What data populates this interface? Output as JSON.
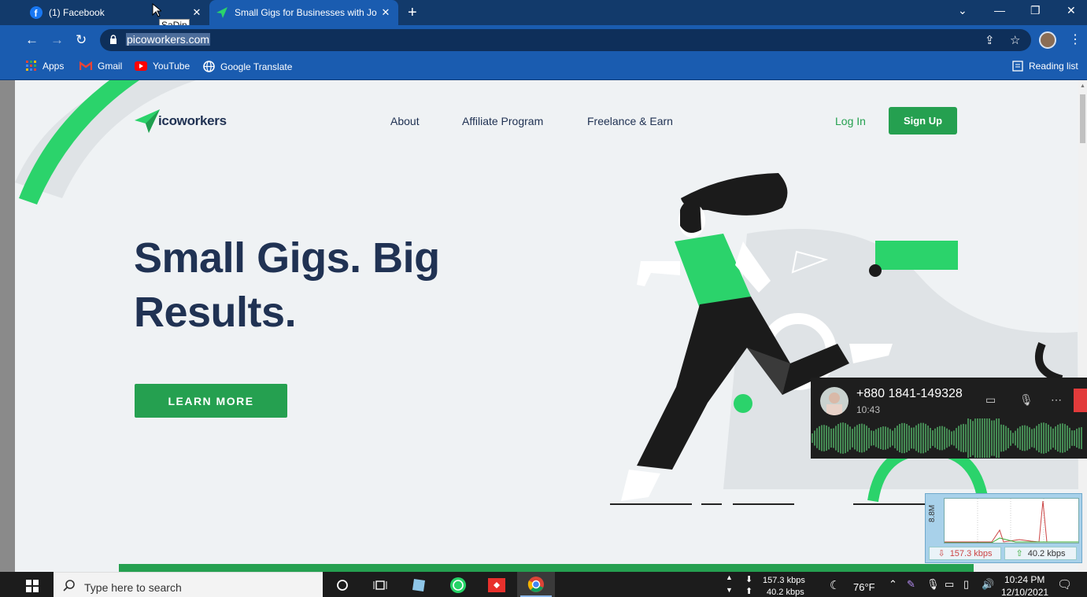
{
  "browser": {
    "tabs": [
      {
        "title": "(1) Facebook",
        "active": false
      },
      {
        "title": "Small Gigs for Businesses with Jo",
        "active": true
      }
    ],
    "tooltip": "SaDin",
    "url": "picoworkers.com",
    "bookmarks": [
      "Apps",
      "Gmail",
      "YouTube",
      "Google Translate"
    ],
    "reading_list": "Reading list"
  },
  "site": {
    "logo_text": "icoworkers",
    "nav": [
      "About",
      "Affiliate Program",
      "Freelance & Earn"
    ],
    "login": "Log In",
    "signup": "Sign Up",
    "hero_line1": "Small Gigs. Big",
    "hero_line2": "Results.",
    "cta": "LEARN MORE",
    "brand_color": "#25a050",
    "text_color": "#203253"
  },
  "call_overlay": {
    "number": "+880 1841-149328",
    "duration": "10:43"
  },
  "net_widget": {
    "scale": "8.8M",
    "download": "157.3 kbps",
    "upload": "40.2 kbps"
  },
  "taskbar": {
    "search_placeholder": "Type here to search",
    "net_down": "157.3 kbps",
    "net_up": "40.2 kbps",
    "weather": "76°F",
    "time": "10:24 PM",
    "date": "12/10/2021"
  }
}
